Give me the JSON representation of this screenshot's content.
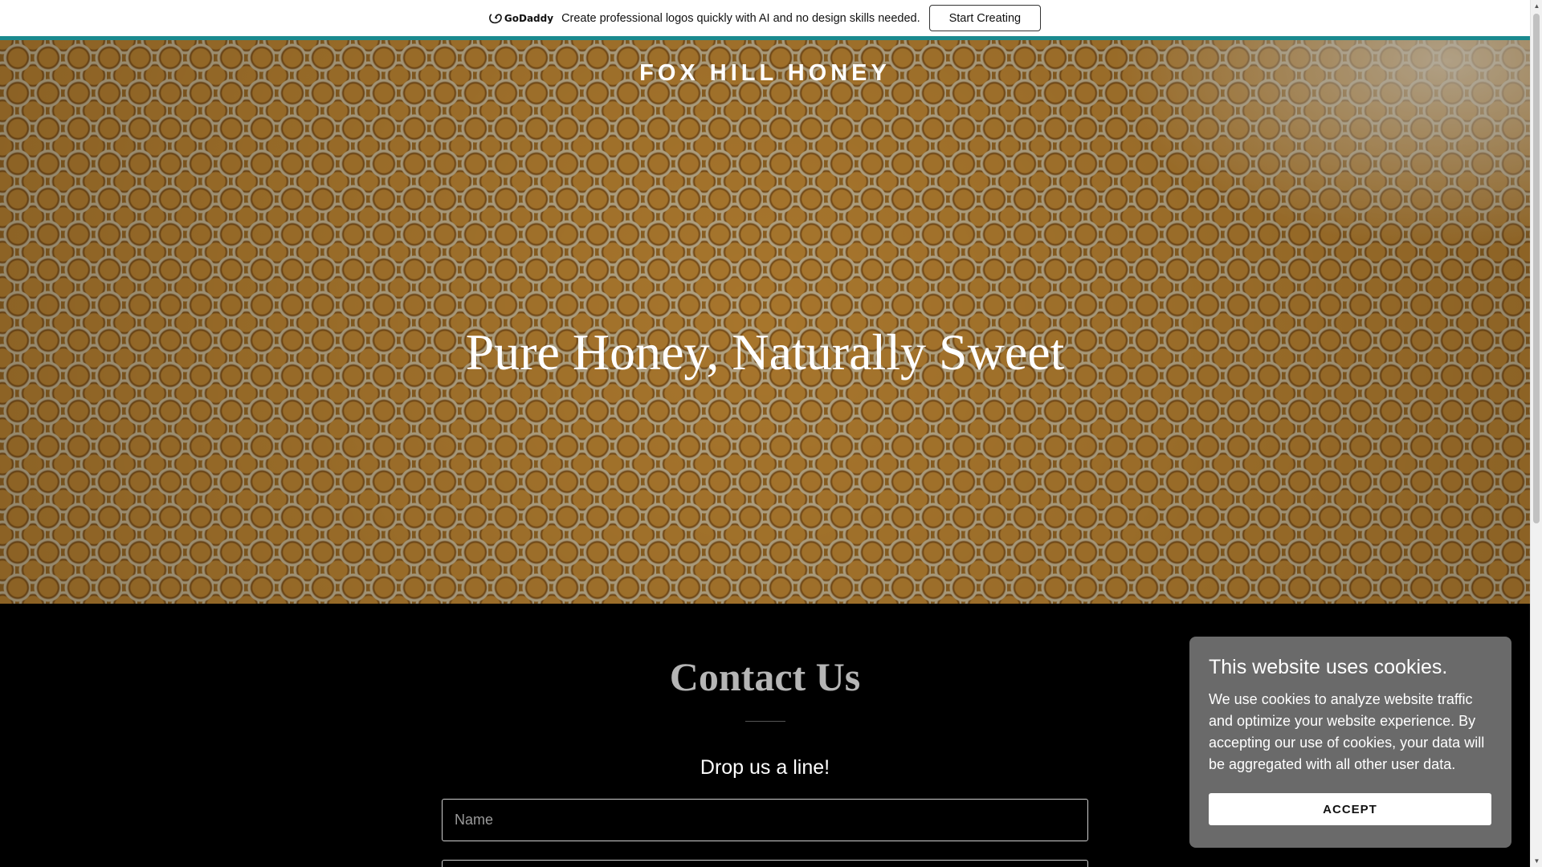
{
  "promo": {
    "brand": "GoDaddy",
    "logo_icon": "godaddy-logo-icon",
    "message": "Create professional logos quickly with AI and no design skills needed.",
    "button_label": "Start Creating",
    "accent_color": "#1b8a8f"
  },
  "hero": {
    "site_title": "FOX HILL HONEY",
    "heading": "Pure Honey, Naturally Sweet",
    "background": "honeycomb-image"
  },
  "contact": {
    "title": "Contact Us",
    "subtitle": "Drop us a line!",
    "name_placeholder": "Name"
  },
  "cookie": {
    "title": "This website uses cookies.",
    "text": "We use cookies to analyze website traffic and optimize your website experience. By accepting our use of cookies, your data will be aggregated with all other user data.",
    "accept_label": "ACCEPT"
  },
  "colors": {
    "page_bg": "#000000",
    "cookie_bg": "#6a6a6a",
    "promo_bg": "#ffffff"
  }
}
